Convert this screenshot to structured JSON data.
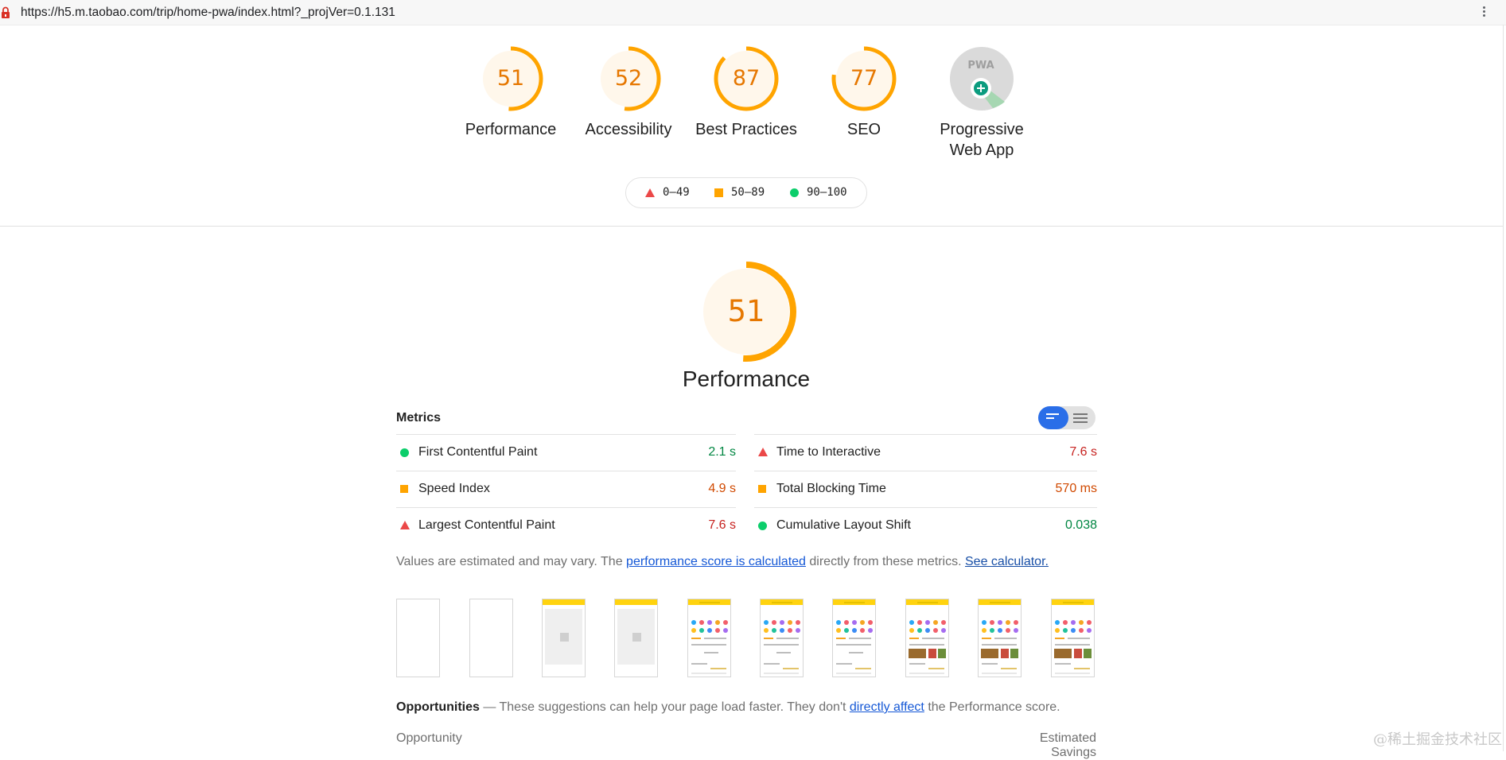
{
  "browser": {
    "url": "https://h5.m.taobao.com/trip/home-pwa/index.html?_projVer=0.1.131"
  },
  "colors": {
    "average": "#ffa400",
    "average_text": "#e67700",
    "fail": "#eb4848",
    "pass": "#0cce6b",
    "toggle_active": "#2a6ee8"
  },
  "categories": [
    {
      "label": "Performance",
      "score": 51
    },
    {
      "label": "Accessibility",
      "score": 52
    },
    {
      "label": "Best Practices",
      "score": 87
    },
    {
      "label": "SEO",
      "score": 77
    }
  ],
  "pwa": {
    "label": "Progressive Web App",
    "badge": "PWA"
  },
  "legend": [
    {
      "icon": "fail-triangle-icon",
      "range": "0–49"
    },
    {
      "icon": "average-square-icon",
      "range": "50–89"
    },
    {
      "icon": "pass-circle-icon",
      "range": "90–100"
    }
  ],
  "performance": {
    "score": 51,
    "title": "Performance"
  },
  "metrics": {
    "heading": "Metrics",
    "left": [
      {
        "name": "First Contentful Paint",
        "value": "2.1 s",
        "rating": "pass"
      },
      {
        "name": "Speed Index",
        "value": "4.9 s",
        "rating": "average"
      },
      {
        "name": "Largest Contentful Paint",
        "value": "7.6 s",
        "rating": "fail"
      }
    ],
    "right": [
      {
        "name": "Time to Interactive",
        "value": "7.6 s",
        "rating": "fail"
      },
      {
        "name": "Total Blocking Time",
        "value": "570 ms",
        "rating": "average"
      },
      {
        "name": "Cumulative Layout Shift",
        "value": "0.038",
        "rating": "pass"
      }
    ]
  },
  "note": {
    "prefix": "Values are estimated and may vary. The",
    "link1": "performance score is calculated",
    "middle": "directly from these metrics.",
    "link2": "See calculator."
  },
  "filmstrip_frames": [
    "blank",
    "blank",
    "skeleton",
    "skeleton",
    "content",
    "content",
    "content",
    "content-images",
    "content-images",
    "content-images"
  ],
  "opportunities": {
    "title": "Opportunities",
    "desc": "— These suggestions can help your page load faster. They don't",
    "link": "directly affect",
    "desc_end": "the Performance score.",
    "col_opportunity": "Opportunity",
    "col_savings": "Estimated Savings"
  },
  "watermark": "@稀土掘金技术社区"
}
